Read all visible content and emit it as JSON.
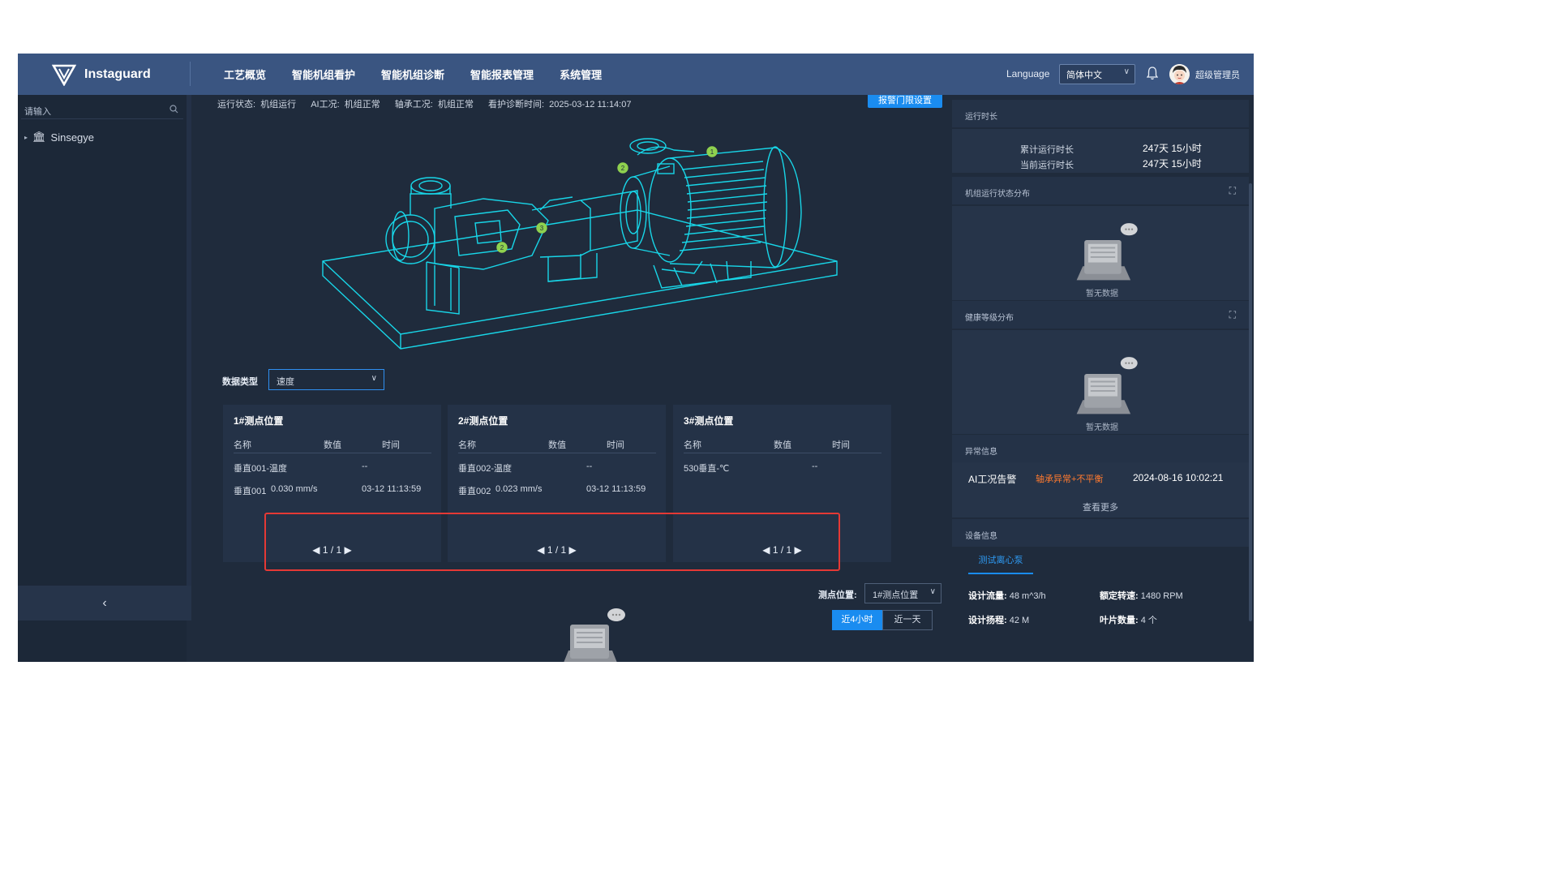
{
  "app": {
    "brand": "Instaguard"
  },
  "nav": [
    "工艺概览",
    "智能机组看护",
    "智能机组诊断",
    "智能报表管理",
    "系统管理"
  ],
  "header": {
    "language_label": "Language",
    "language_value": "简体中文",
    "user": "超级管理员"
  },
  "sidebar": {
    "search_placeholder": "请输入",
    "tree_root": "Sinsegye"
  },
  "status": {
    "run_label": "运行状态:",
    "run_value": "机组运行",
    "ai_label": "AI工况:",
    "ai_value": "机组正常",
    "bearing_label": "轴承工况:",
    "bearing_value": "机组正常",
    "time_label": "看护诊断时间:",
    "time_value": "2025-03-12 11:14:07",
    "alarm_button": "报警门限设置"
  },
  "pump_markers": [
    "1",
    "2",
    "3",
    "2"
  ],
  "data_type": {
    "label": "数据类型",
    "value": "速度"
  },
  "cards": [
    {
      "title": "1#测点位置",
      "headers": [
        "名称",
        "数值",
        "时间"
      ],
      "rows": [
        {
          "name": "垂直001-温度",
          "value": "",
          "time": "--"
        },
        {
          "name": "垂直001",
          "value": "0.030 mm/s",
          "time": "03-12 11:13:59"
        }
      ],
      "pager": "1 / 1"
    },
    {
      "title": "2#测点位置",
      "headers": [
        "名称",
        "数值",
        "时间"
      ],
      "rows": [
        {
          "name": "垂直002-温度",
          "value": "",
          "time": "--"
        },
        {
          "name": "垂直002",
          "value": "0.023 mm/s",
          "time": "03-12 11:13:59"
        }
      ],
      "pager": "1 / 1"
    },
    {
      "title": "3#测点位置",
      "headers": [
        "名称",
        "数值",
        "时间"
      ],
      "rows": [
        {
          "name": "530垂直-℃",
          "value": "",
          "time": "--"
        }
      ],
      "pager": "1 / 1"
    }
  ],
  "measure": {
    "label": "测点位置:",
    "value": "1#测点位置",
    "ranges": [
      "近4小时",
      "近一天"
    ],
    "active_range": 0
  },
  "right": {
    "runtime": {
      "title": "运行时长",
      "total_label": "累计运行时长",
      "total_value": "247天 15小时",
      "current_label": "当前运行时长",
      "current_value": "247天 15小时"
    },
    "state_dist": {
      "title": "机组运行状态分布",
      "empty": "暂无数据"
    },
    "health_dist": {
      "title": "健康等级分布",
      "empty": "暂无数据"
    },
    "abnormal": {
      "title": "异常信息",
      "type": "AI工况告警",
      "detail": "轴承异常+不平衡",
      "time": "2024-08-16 10:02:21",
      "more": "查看更多"
    },
    "device": {
      "title": "设备信息",
      "tab": "测试离心泵",
      "flow_label": "设计流量:",
      "flow_value": "48 m^3/h",
      "speed_label": "额定转速:",
      "speed_value": "1480 RPM",
      "head_label": "设计扬程:",
      "head_value": "42 M",
      "blades_label": "叶片数量:",
      "blades_value": "4 个"
    }
  },
  "colors": {
    "accent": "#1a8cf0",
    "topbar": "#3a5581",
    "wireframe": "#18d6e8",
    "marker": "#8fd14f",
    "alert": "#ff7a2f",
    "highlight": "#e53935"
  }
}
